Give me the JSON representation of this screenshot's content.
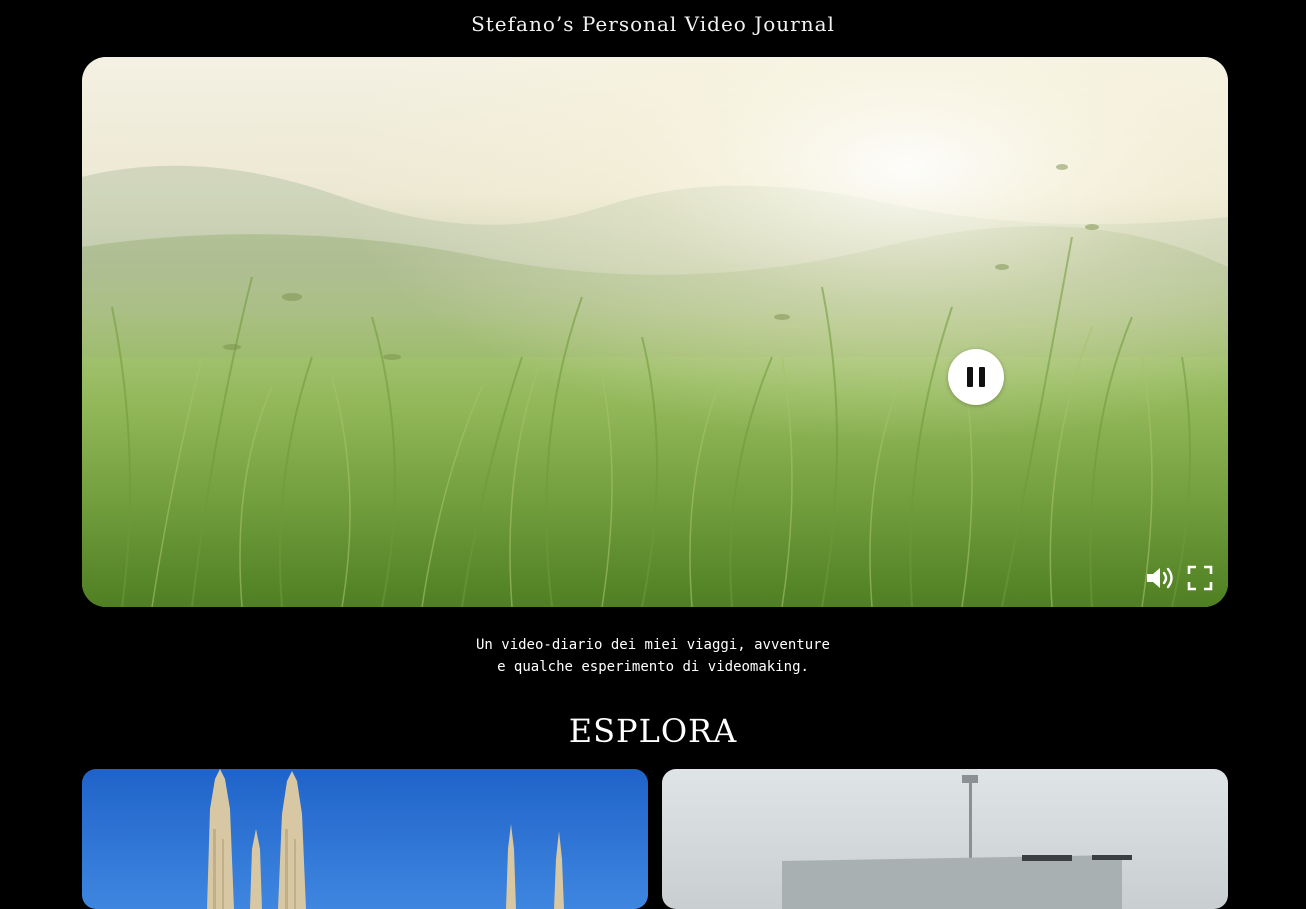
{
  "header": {
    "title": "Stefano’s Personal Video Journal"
  },
  "hero": {
    "state": "playing",
    "controls": {
      "pause_icon": "pause-icon",
      "volume_icon": "volume-icon",
      "fullscreen_icon": "fullscreen-icon"
    }
  },
  "intro": {
    "line1": "Un video-diario dei miei viaggi, avventure",
    "line2": "e qualche esperimento di videomaking."
  },
  "explore": {
    "title": "ESPLORA"
  },
  "colors": {
    "background": "#000000",
    "text": "#ffffff",
    "control_bg": "#ffffff"
  }
}
